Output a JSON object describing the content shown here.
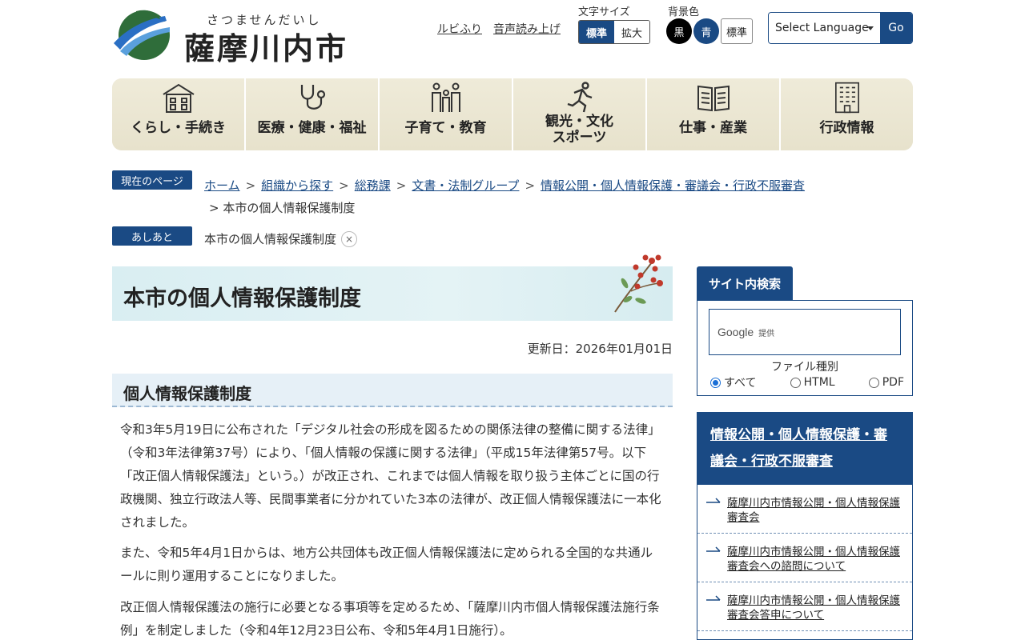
{
  "header": {
    "logo_ruby": "さつませんだいし",
    "logo_name": "薩摩川内市",
    "util_links": [
      "ルビふり",
      "音声読み上げ"
    ],
    "font_size": {
      "label": "文字サイズ",
      "standard": "標準",
      "large": "拡大",
      "selected": "標準"
    },
    "bg_color": {
      "label": "背景色",
      "black": "黒",
      "blue": "青",
      "standard": "標準"
    },
    "language": {
      "select_label": "Select Language",
      "go_label": "Go"
    }
  },
  "global_nav": [
    {
      "label": "くらし・手続き",
      "icon": "house-icon"
    },
    {
      "label": "医療・健康・福祉",
      "icon": "stethoscope-icon"
    },
    {
      "label": "子育て・教育",
      "icon": "family-icon"
    },
    {
      "label_line1": "観光・文化",
      "label_line2": "スポーツ",
      "icon": "runner-icon"
    },
    {
      "label": "仕事・産業",
      "icon": "book-icon"
    },
    {
      "label": "行政情報",
      "icon": "building-icon"
    }
  ],
  "breadcrumb": {
    "tag": "現在のページ",
    "items": [
      "ホーム",
      "組織から探す",
      "総務課",
      "文書・法制グループ",
      "情報公開・個人情報保護・審議会・行政不服審査"
    ],
    "current": "本市の個人情報保護制度"
  },
  "ashiato": {
    "tag": "あしあと",
    "item": "本市の個人情報保護制度",
    "close": "×"
  },
  "main": {
    "title": "本市の個人情報保護制度",
    "updated": "更新日：2026年01月01日",
    "heading": "個人情報保護制度",
    "paragraphs": [
      "令和3年5月19日に公布された「デジタル社会の形成を図るための関係法律の整備に関する法律」（令和3年法律第37号）により、「個人情報の保護に関する法律」（平成15年法律第57号。以下「改正個人情報保護法」という。）が改正され、これまでは個人情報を取り扱う主体ごとに国の行政機関、独立行政法人等、民間事業者に分かれていた3本の法律が、改正個人情報保護法に一本化されました。",
      "また、令和5年4月1日からは、地方公共団体も改正個人情報保護法に定められる全国的な共通ルールに則り運用することになりました。",
      "改正個人情報保護法の施行に必要となる事項等を定めるため、「薩摩川内市個人情報保護法施行条例」を制定しました（令和4年12月23日公布、令和5年4月1日施行）。"
    ]
  },
  "sidebar": {
    "search": {
      "tab": "サイト内検索",
      "google_word": "Google",
      "google_by": "提供",
      "filetype_label": "ファイル種別",
      "options": [
        "すべて",
        "HTML",
        "PDF"
      ],
      "selected": "すべて"
    },
    "related": {
      "heading": "情報公開・個人情報保護・審議会・行政不服審査",
      "items": [
        "薩摩川内市情報公開・個人情報保護審査会",
        "薩摩川内市情報公開・個人情報保護審査会への諮問について",
        "薩摩川内市情報公開・個人情報保護審査会答申について"
      ]
    }
  },
  "colors": {
    "brand": "#1a4a84",
    "nav_bg": "#ece8d6",
    "title_bg": "#d9eef2",
    "heading_bg": "#e6f0f7"
  }
}
